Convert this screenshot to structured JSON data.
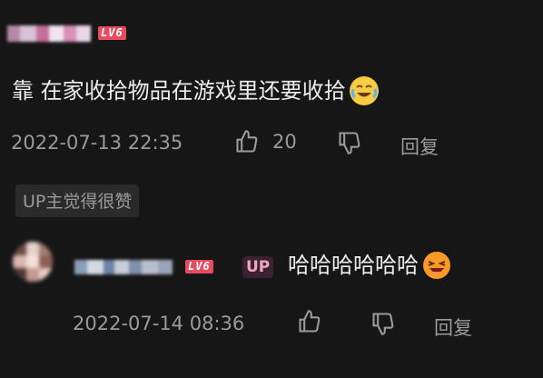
{
  "comment": {
    "level": "LV6",
    "text": "靠 在家收拾物品在游戏里还要收拾",
    "emoji": "crying-laughing-emoji",
    "timestamp": "2022-07-13 22:35",
    "like_count": "20",
    "reply_label": "回复",
    "up_liked_label": "UP主觉得很赞"
  },
  "reply": {
    "level": "LV6",
    "up_badge": "UP",
    "text": "哈哈哈哈哈哈",
    "emoji": "laughing-emoji",
    "timestamp": "2022-07-14 08:36",
    "reply_label": "回复"
  },
  "colors": {
    "background": "#161616",
    "text": "#ececec",
    "meta": "#9a9a9a",
    "level_badge": "#e84a5f",
    "up_badge_bg": "#3a2230",
    "up_badge_text": "#f0a7bd"
  }
}
